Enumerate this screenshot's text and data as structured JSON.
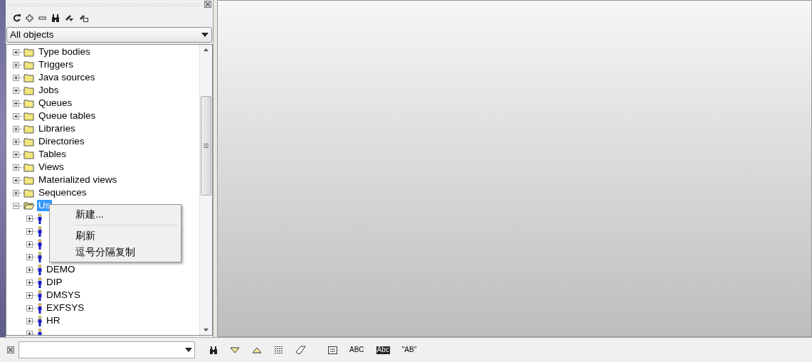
{
  "object_filter": {
    "value": "All objects"
  },
  "tree": [
    {
      "label": "Type bodies",
      "expanded": false,
      "selected": false
    },
    {
      "label": "Triggers",
      "expanded": false,
      "selected": false
    },
    {
      "label": "Java sources",
      "expanded": false,
      "selected": false
    },
    {
      "label": "Jobs",
      "expanded": false,
      "selected": false
    },
    {
      "label": "Queues",
      "expanded": false,
      "selected": false
    },
    {
      "label": "Queue tables",
      "expanded": false,
      "selected": false
    },
    {
      "label": "Libraries",
      "expanded": false,
      "selected": false
    },
    {
      "label": "Directories",
      "expanded": false,
      "selected": false
    },
    {
      "label": "Tables",
      "expanded": false,
      "selected": false
    },
    {
      "label": "Views",
      "expanded": false,
      "selected": false
    },
    {
      "label": "Materialized views",
      "expanded": false,
      "selected": false
    },
    {
      "label": "Sequences",
      "expanded": false,
      "selected": false
    },
    {
      "label": "Us",
      "expanded": true,
      "selected": true,
      "children": [
        {
          "kind": "user"
        },
        {
          "kind": "user"
        },
        {
          "kind": "user"
        },
        {
          "kind": "user"
        },
        {
          "kind": "user",
          "label": "DEMO"
        },
        {
          "kind": "user",
          "label": "DIP"
        },
        {
          "kind": "user",
          "label": "DMSYS"
        },
        {
          "kind": "user",
          "label": "EXFSYS"
        },
        {
          "kind": "user",
          "label": "HR"
        },
        {
          "kind": "user"
        }
      ]
    }
  ],
  "context_menu": [
    {
      "kind": "item",
      "label": "新建..."
    },
    {
      "kind": "separator"
    },
    {
      "kind": "item",
      "label": "刷新"
    },
    {
      "kind": "item",
      "label": "逗号分隔复制"
    }
  ],
  "find_bar": {
    "text_buttons": [
      "ABC",
      "Abc",
      "\"AB\""
    ]
  }
}
